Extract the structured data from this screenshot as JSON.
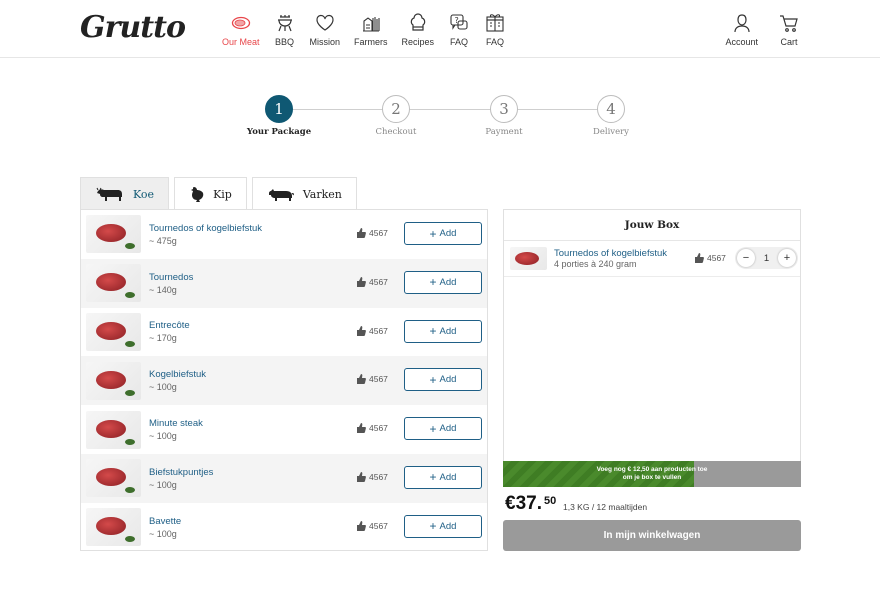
{
  "brand": {
    "logo": "Grutto"
  },
  "nav": {
    "items": [
      {
        "label": "Our Meat",
        "icon": "steak-icon",
        "active": true
      },
      {
        "label": "BBQ",
        "icon": "bbq-icon"
      },
      {
        "label": "Mission",
        "icon": "heart-icon"
      },
      {
        "label": "Farmers",
        "icon": "farm-icon"
      },
      {
        "label": "Recipes",
        "icon": "chef-hat-icon"
      },
      {
        "label": "FAQ",
        "icon": "faq-icon"
      },
      {
        "label": "FAQ",
        "icon": "gift-icon"
      }
    ],
    "account": "Account",
    "cart": "Cart"
  },
  "steps": [
    {
      "number": "1",
      "label": "Your Package",
      "active": true
    },
    {
      "number": "2",
      "label": "Checkout"
    },
    {
      "number": "3",
      "label": "Payment"
    },
    {
      "number": "4",
      "label": "Delivery"
    }
  ],
  "tabs": [
    {
      "label": "Koe",
      "icon": "cow-icon",
      "active": true
    },
    {
      "label": "Kip",
      "icon": "chicken-icon"
    },
    {
      "label": "Varken",
      "icon": "pig-icon"
    }
  ],
  "products": [
    {
      "name": "Tournedos of kogelbiefstuk",
      "weight": "~ 475g",
      "likes": "4567",
      "add_label": "Add"
    },
    {
      "name": "Tournedos",
      "weight": "~ 140g",
      "likes": "4567",
      "add_label": "Add"
    },
    {
      "name": "Entrecôte",
      "weight": "~ 170g",
      "likes": "4567",
      "add_label": "Add"
    },
    {
      "name": "Kogelbiefstuk",
      "weight": "~ 100g",
      "likes": "4567",
      "add_label": "Add"
    },
    {
      "name": "Minute steak",
      "weight": "~ 100g",
      "likes": "4567",
      "add_label": "Add"
    },
    {
      "name": "Biefstukpuntjes",
      "weight": "~ 100g",
      "likes": "4567",
      "add_label": "Add"
    },
    {
      "name": "Bavette",
      "weight": "~ 100g",
      "likes": "4567",
      "add_label": "Add"
    }
  ],
  "box": {
    "title": "Jouw Box",
    "items": [
      {
        "name": "Tournedos of kogelbiefstuk",
        "sub": "4 porties à 240 gram",
        "likes": "4567",
        "quantity": "1"
      }
    ],
    "progress": {
      "fraction": 0.64,
      "line1": "Voeg nog  € 12,50 aan producten toe",
      "line2": "om je box te vullen",
      "fill_color": "#4a8a2c"
    },
    "price_main": "€37.",
    "price_cents": "50",
    "price_meta": "1,3 KG / 12 maaltijden",
    "cart_button": "In mijn winkelwagen"
  },
  "colors": {
    "accent": "#0f5873",
    "link": "#1f5f86",
    "active_nav": "#e8464a"
  }
}
